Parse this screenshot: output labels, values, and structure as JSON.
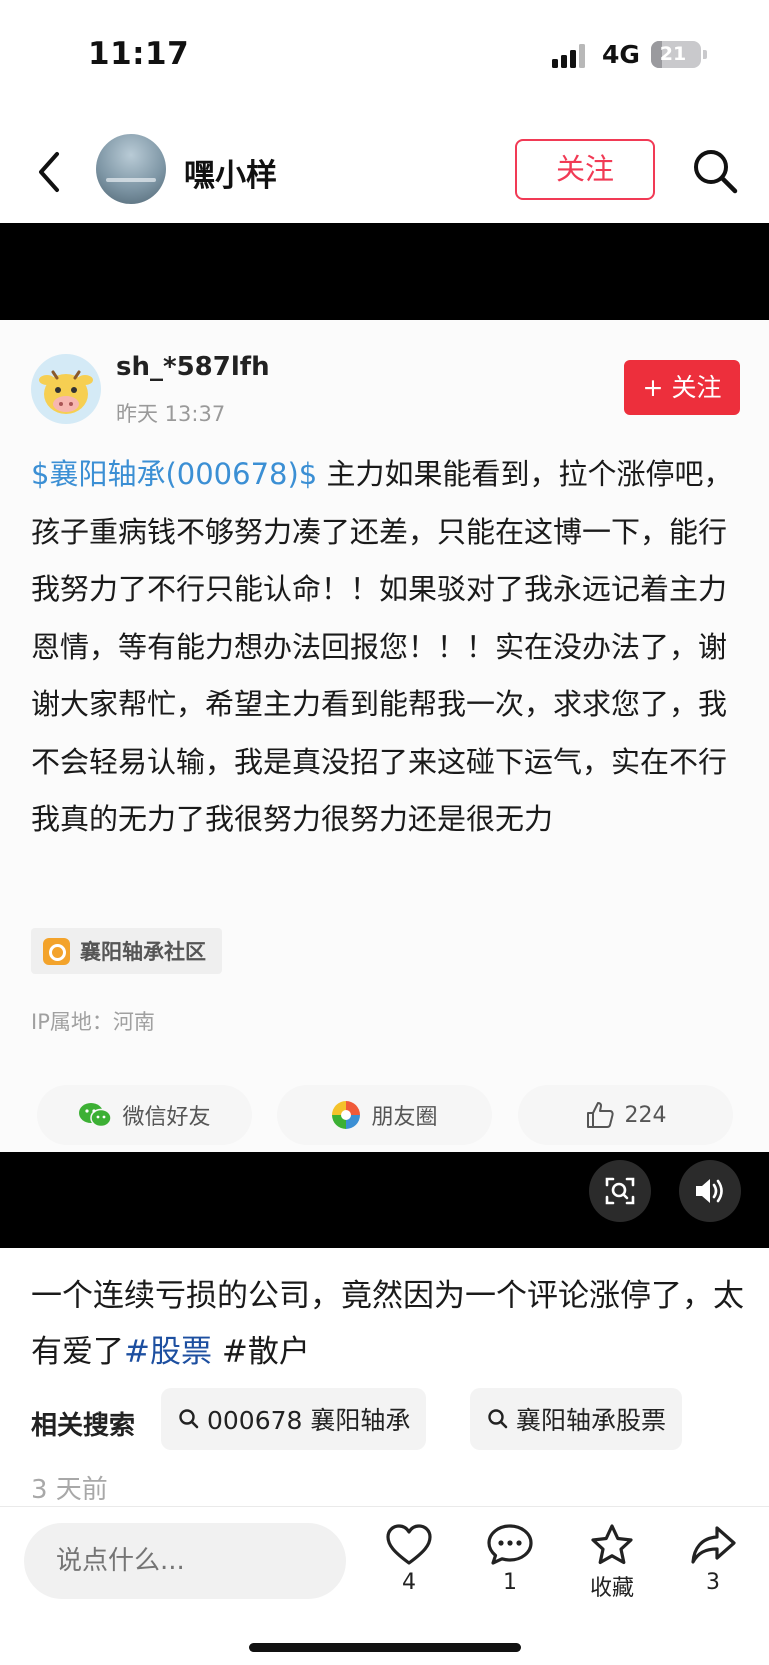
{
  "status_bar": {
    "time": "11:17",
    "network": "4G",
    "battery": "21",
    "battery_level": 0.21
  },
  "header": {
    "username": "嘿小样",
    "follow_label": "关注"
  },
  "post": {
    "author": "sh_*587lfh",
    "time": "昨天 13:37",
    "follow_label": "+ 关注",
    "stock_tag": "$襄阳轴承(000678)$",
    "body": " 主力如果能看到，拉个涨停吧，孩子重病钱不够努力凑了还差，只能在这博一下，能行我努力了不行只能认命！！如果驳对了我永远记着主力恩情，等有能力想办法回报您！！！实在没办法了，谢谢大家帮忙，希望主力看到能帮我一次，求求您了，我不会轻易认输，我是真没招了来这碰下运气，实在不行我真的无力了我很努力很努力还是很无力",
    "community": "襄阳轴承社区",
    "ip": "IP属地：河南",
    "share_wechat": "微信好友",
    "share_moments": "朋友圈",
    "likes": "224"
  },
  "caption": {
    "text": "一个连续亏损的公司，竟然因为一个评论涨停了，太有爱了",
    "tag1": "#股票",
    "tag2": " #散户"
  },
  "related": {
    "label": "相关搜索",
    "chips": [
      "000678 襄阳轴承",
      "襄阳轴承股票"
    ]
  },
  "posted_ago": "3 天前",
  "bottom": {
    "comment_placeholder": "说点什么...",
    "like_count": "4",
    "comment_count": "1",
    "favorite_label": "收藏",
    "share_count": "3"
  },
  "colors": {
    "accent": "#f13a55",
    "follow_bg": "#ed2f3c",
    "stock_link": "#3b8fd4",
    "hashtag": "#1d4fa0"
  }
}
